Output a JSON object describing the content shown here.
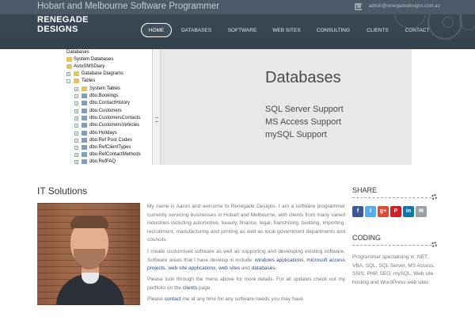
{
  "header": {
    "tagline": "Hobart and Melbourne Software Programmer",
    "email": "admin@renegadedesigns.com.au",
    "logo_line1": "RENEGADE",
    "logo_line2": "DESIGNS",
    "nav": [
      {
        "label": "HOME",
        "active": true
      },
      {
        "label": "DATABASES"
      },
      {
        "label": "SOFTWARE"
      },
      {
        "label": "WEB SITES"
      },
      {
        "label": "CONSULTING"
      },
      {
        "label": "CLIENTS"
      },
      {
        "label": "CONTACT"
      }
    ]
  },
  "banner": {
    "tree": [
      "Databases",
      "System Databases",
      "AutoSMSDiary",
      "Database Diagrams",
      "Tables",
      "System Tables",
      "dbo.Bookings",
      "dbo.ContactHistory",
      "dbo.Customers",
      "dbo.CustomersContacts",
      "dbo.CustomersVehicles",
      "dbo.Holidays",
      "dbo.Ref Post Codes",
      "dbo.RefClientTypes",
      "dbo.RefContactMethods",
      "dbo.RefFAQ"
    ],
    "title": "Databases",
    "lines": [
      "SQL Server Support",
      "MS Access Support",
      "mySQL Support"
    ]
  },
  "main": {
    "section_title": "IT Solutions",
    "p1": "My name is Aaron and welcome to Renegade Designs. I am a software programmer currently servicing businesses in Hobart and Melbourne, with clients from many varied industries including automotive, beauty, finance, legal, franchising, building, importing, recruitment, manufacturing and printing as well as local government departments and councils.",
    "p2_a": "I create customised software as well as supporting and developing existing software. Software areas that I have develop in include: ",
    "p2_l1": "windows applications",
    "p2_c1": ", ",
    "p2_l2": "microsoft access projects",
    "p2_c2": ", ",
    "p2_l3": "web site applications",
    "p2_c3": ", ",
    "p2_l4": "web sites",
    "p2_c4": " and ",
    "p2_l5": "databases",
    "p2_end": ".",
    "p3_a": "Please look through the menu above for more details. For all updates check out my portfolio on the ",
    "p3_link": "clients",
    "p3_b": " page.",
    "p4_a": "Please ",
    "p4_link": "contact",
    "p4_b": " me at any time for any software needs you may have."
  },
  "sidebar": {
    "share_title": "SHARE",
    "share_buttons": [
      "f",
      "t",
      "g+",
      "P",
      "in",
      "✉"
    ],
    "coding_title": "CODING",
    "coding_text": "Programmer specialising in .NET, VBA, SQL, SQL Server, MS Access, SSIS, PHP, SEO, mySQL, Web site hosting and WordPress web sites"
  }
}
